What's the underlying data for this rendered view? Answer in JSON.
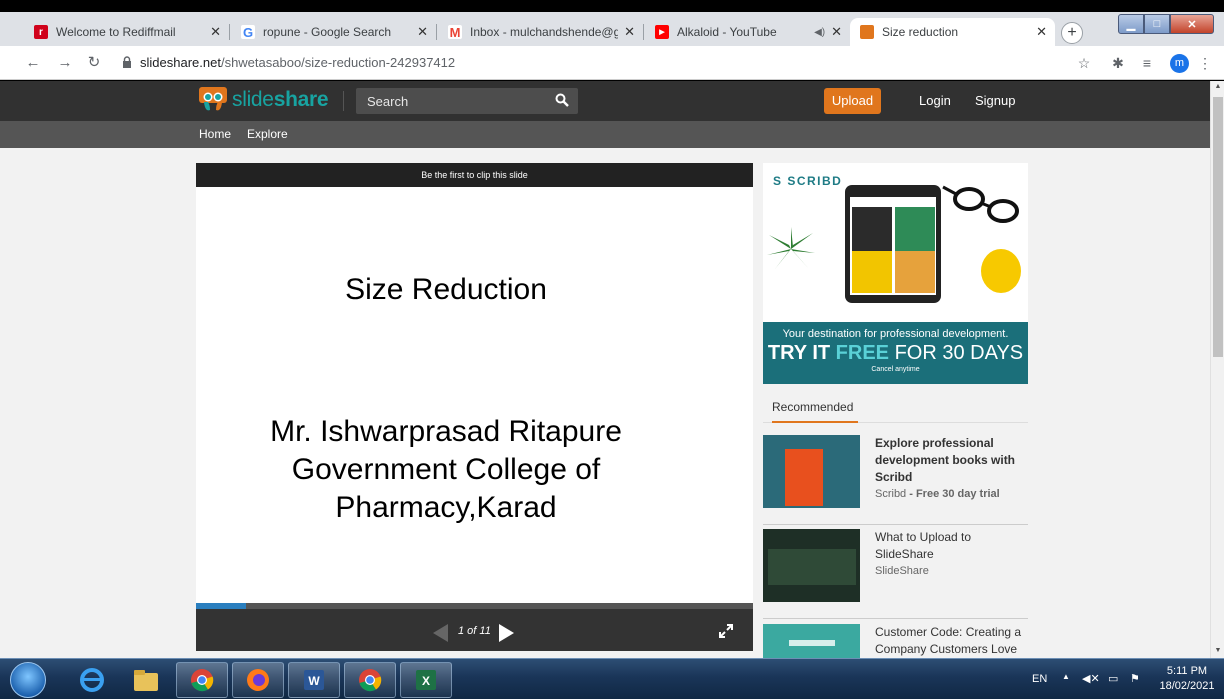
{
  "browser": {
    "tabs": [
      {
        "title": "Welcome to Rediffmail",
        "icon": "rediffmail-icon",
        "color": "#d0021b"
      },
      {
        "title": "ropune - Google Search",
        "icon": "google-icon",
        "color": "#4285f4"
      },
      {
        "title": "Inbox - mulchandshende@gmai",
        "icon": "gmail-icon",
        "color": "#ea4335"
      },
      {
        "title": "Alkaloid - YouTube",
        "icon": "youtube-icon",
        "color": "#ff0000"
      },
      {
        "title": "Size reduction",
        "icon": "slideshare-icon",
        "color": "#e0761d"
      }
    ],
    "new_tab_label": "+",
    "url_host": "slideshare.net",
    "url_path": "/shwetasaboo/size-reduction-242937412",
    "avatar_letter": "m"
  },
  "slideshare": {
    "logo_light": "slide",
    "logo_bold": "share",
    "search_label": "Search",
    "upload_label": "Upload",
    "login_label": "Login",
    "signup_label": "Signup",
    "nav": [
      "Home",
      "Explore"
    ]
  },
  "player": {
    "clip_label": "Be the first to clip this slide",
    "slide_title": "Size Reduction",
    "author_line1": "Mr. Ishwarprasad Ritapure",
    "author_line2": "Government College of",
    "author_line3": "Pharmacy,Karad",
    "page_label": "1 of 11",
    "progress_fraction": 0.09
  },
  "ad": {
    "brand": "SCRIBD",
    "line1": "Your destination for professional development.",
    "line2_try": "TRY IT",
    "line2_free": "FREE",
    "line2_rest": "FOR 30 DAYS",
    "line3": "Cancel anytime",
    "colors": {
      "band": "#1b6f7a",
      "free": "#5ad1d7",
      "cup": "#f7c900"
    }
  },
  "recommended": {
    "heading": "Recommended",
    "items": [
      {
        "title": "Explore professional development books with Scribd",
        "source": "Scribd",
        "source_extra": " - Free 30 day trial"
      },
      {
        "title": "What to Upload to SlideShare",
        "source": "SlideShare",
        "source_extra": ""
      },
      {
        "title": "Customer Code: Creating a Company Customers Love",
        "source": "",
        "source_extra": ""
      }
    ]
  },
  "taskbar": {
    "language": "EN",
    "time": "5:11 PM",
    "date": "18/02/2021"
  }
}
